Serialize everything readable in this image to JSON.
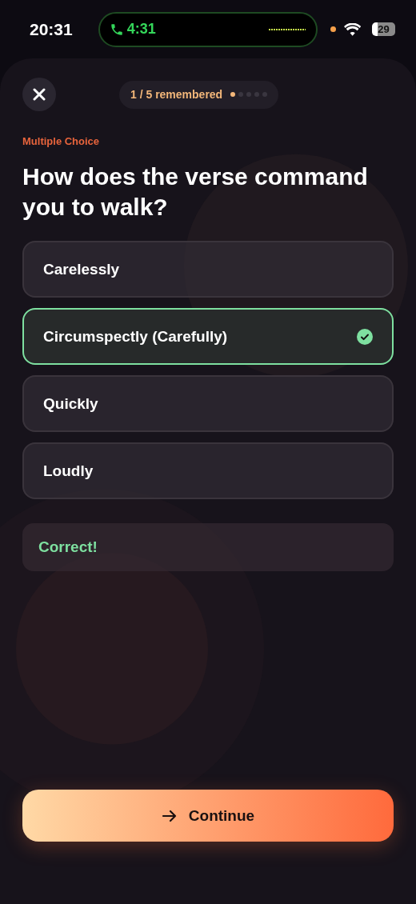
{
  "status_bar": {
    "time": "20:31",
    "call_timer": "4:31",
    "battery": "29"
  },
  "header": {
    "progress": "1 / 5 remembered",
    "dots": [
      {
        "filled": true
      },
      {
        "filled": false
      },
      {
        "filled": false
      },
      {
        "filled": false
      },
      {
        "filled": false
      }
    ]
  },
  "question": {
    "type_label": "Multiple Choice",
    "text": "How does the verse command you to walk?"
  },
  "options": [
    {
      "label": "Carelessly",
      "selected": false
    },
    {
      "label": "Circumspectly (Carefully)",
      "selected": true
    },
    {
      "label": "Quickly",
      "selected": false
    },
    {
      "label": "Loudly",
      "selected": false
    }
  ],
  "feedback": "Correct!",
  "continue_button": "Continue"
}
